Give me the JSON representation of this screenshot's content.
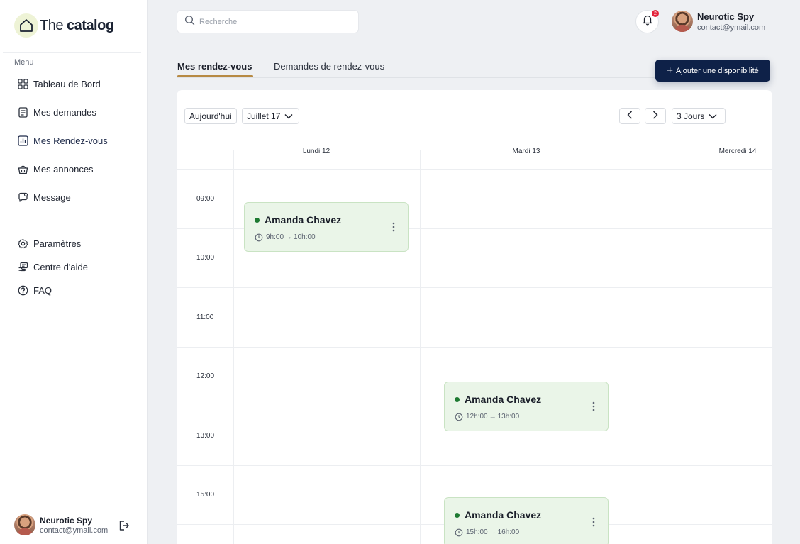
{
  "brand": {
    "name_light": "The ",
    "name_bold": "catalog"
  },
  "sidebar": {
    "menu_title": "Menu",
    "items": [
      {
        "label": "Tableau de Bord",
        "icon": "grid-icon"
      },
      {
        "label": "Mes demandes",
        "icon": "document-icon"
      },
      {
        "label": "Mes Rendez-vous",
        "icon": "chart-icon",
        "active": true
      },
      {
        "label": "Mes annonces",
        "icon": "basket-icon"
      },
      {
        "label": "Message",
        "icon": "chat-icon"
      }
    ],
    "secondary": [
      {
        "label": "Paramètres",
        "icon": "gear-icon"
      },
      {
        "label": "Centre d'aide",
        "icon": "help-center-icon"
      },
      {
        "label": "FAQ",
        "icon": "question-icon"
      }
    ],
    "user": {
      "name": "Neurotic Spy",
      "email": "contact@ymail.com"
    }
  },
  "header": {
    "search_placeholder": "Recherche",
    "notifications_count": "2",
    "user": {
      "name": "Neurotic Spy",
      "email": "contact@ymail.com"
    }
  },
  "tabs": [
    {
      "label": "Mes rendez-vous",
      "active": true
    },
    {
      "label": "Demandes de rendez-vous",
      "active": false
    }
  ],
  "add_button_label": "Ajouter une disponibilité",
  "calendar": {
    "today_label": "Aujourd'hui",
    "month_label": "Juillet 17",
    "view_label": "3 Jours",
    "days": [
      "Lundi 12",
      "Mardi 13",
      "Mercredi 14"
    ],
    "times": [
      "09:00",
      "10:00",
      "11:00",
      "12:00",
      "13:00",
      "15:00"
    ],
    "events": [
      {
        "name": "Amanda Chavez",
        "start": "9h:00",
        "end": "10h:00",
        "day": "Lundi 12"
      },
      {
        "name": "Amanda Chavez",
        "start": "12h:00",
        "end": "13h:00",
        "day": "Mardi 13"
      },
      {
        "name": "Amanda Chavez",
        "start": "15h:00",
        "end": "16h:00",
        "day": "Mardi 13"
      }
    ]
  },
  "colors": {
    "primary": "#0e2148",
    "accent": "#b78a44",
    "event_bg": "#eaf5e8",
    "event_dot": "#1e7a32",
    "badge": "#e3243b"
  }
}
